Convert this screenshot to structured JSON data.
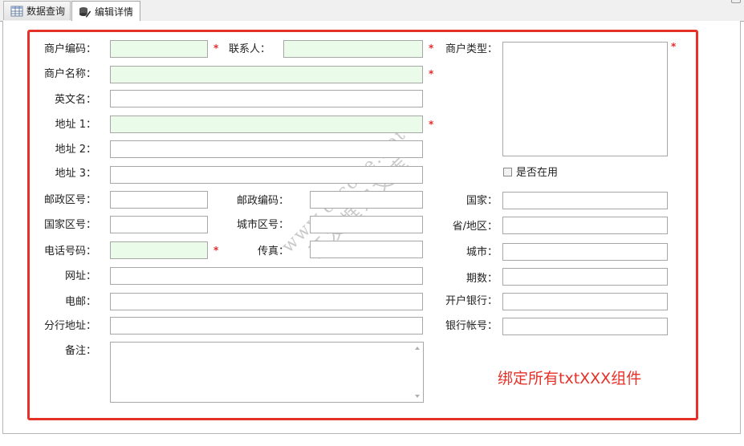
{
  "tabs": [
    {
      "label": "数据查询",
      "icon": "table-grid-icon",
      "active": false
    },
    {
      "label": "编辑详情",
      "icon": "database-edit-icon",
      "active": true
    }
  ],
  "form": {
    "merchant_code": {
      "label": "商户编码：",
      "value": "",
      "required": true
    },
    "contact": {
      "label": "联系人：",
      "value": "",
      "required": true
    },
    "merchant_type": {
      "label": "商户类型：",
      "required": true
    },
    "merchant_name": {
      "label": "商户名称：",
      "value": "",
      "required": true
    },
    "english_name": {
      "label": "英文名：",
      "value": ""
    },
    "address1": {
      "label": "地址 1：",
      "value": "",
      "required": true
    },
    "address2": {
      "label": "地址 2：",
      "value": ""
    },
    "address3": {
      "label": "地址 3：",
      "value": ""
    },
    "in_use": {
      "label": "是否在用",
      "checked": false
    },
    "postal_area": {
      "label": "邮政区号：",
      "value": ""
    },
    "postal_code": {
      "label": "邮政编码：",
      "value": ""
    },
    "country": {
      "label": "国家：",
      "value": ""
    },
    "country_code": {
      "label": "国家区号：",
      "value": ""
    },
    "city_code": {
      "label": "城市区号：",
      "value": ""
    },
    "province": {
      "label": "省/地区：",
      "value": ""
    },
    "phone": {
      "label": "电话号码：",
      "value": "",
      "required": true
    },
    "fax": {
      "label": "传真：",
      "value": ""
    },
    "city": {
      "label": "城市：",
      "value": ""
    },
    "website": {
      "label": "网址：",
      "value": ""
    },
    "period": {
      "label": "期数：",
      "value": ""
    },
    "email": {
      "label": "电邮：",
      "value": ""
    },
    "bank": {
      "label": "开户银行：",
      "value": ""
    },
    "branch_address": {
      "label": "分行地址：",
      "value": ""
    },
    "bank_account": {
      "label": "银行帐号：",
      "value": ""
    },
    "remarks": {
      "label": "备注：",
      "value": ""
    }
  },
  "required_mark": "*",
  "annotation": "绑定所有txtXXX组件",
  "watermark": {
    "line1": "www.cscode.net",
    "line2": "开发框架文库"
  },
  "colors": {
    "highlight_red": "#e53228",
    "required_bg": "#ebfbe9",
    "required_star": "#e52b2b"
  }
}
